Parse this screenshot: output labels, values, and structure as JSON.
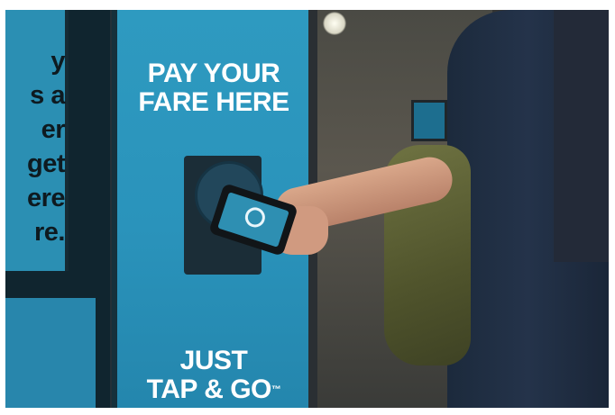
{
  "left_screen": {
    "text": "y\ns a\ner\n get\nere\nre."
  },
  "fare_panel": {
    "title_line1": "PAY YOUR",
    "title_line2": "FARE HERE",
    "footer_line1": "JUST",
    "footer_line2": "TAP & GO",
    "trademark": "™"
  },
  "colors": {
    "panel_blue": "#2a93bb",
    "jacket_navy": "#24334a",
    "bag_olive": "#5b5f33"
  },
  "icons": {
    "phone": "smartphone-icon",
    "reader": "contactless-reader-icon"
  }
}
